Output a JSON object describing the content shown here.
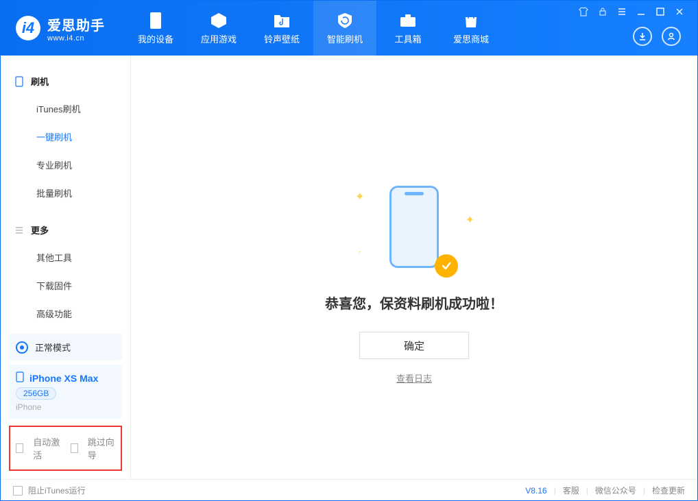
{
  "logo": {
    "title": "爱思助手",
    "subtitle": "www.i4.cn"
  },
  "nav": {
    "items": [
      {
        "label": "我的设备"
      },
      {
        "label": "应用游戏"
      },
      {
        "label": "铃声壁纸"
      },
      {
        "label": "智能刷机"
      },
      {
        "label": "工具箱"
      },
      {
        "label": "爱思商城"
      }
    ]
  },
  "sidebar": {
    "group1_title": "刷机",
    "group1_items": [
      {
        "label": "iTunes刷机"
      },
      {
        "label": "一键刷机"
      },
      {
        "label": "专业刷机"
      },
      {
        "label": "批量刷机"
      }
    ],
    "group2_title": "更多",
    "group2_items": [
      {
        "label": "其他工具"
      },
      {
        "label": "下载固件"
      },
      {
        "label": "高级功能"
      }
    ]
  },
  "mode": {
    "label": "正常模式"
  },
  "device": {
    "name": "iPhone XS Max",
    "capacity": "256GB",
    "type": "iPhone"
  },
  "options": {
    "auto_activate": "自动激活",
    "skip_guide": "跳过向导"
  },
  "main": {
    "success_text": "恭喜您，保资料刷机成功啦！",
    "ok_label": "确定",
    "log_link": "查看日志"
  },
  "footer": {
    "block_itunes": "阻止iTunes运行",
    "version": "V8.16",
    "links": [
      "客服",
      "微信公众号",
      "检查更新"
    ]
  }
}
